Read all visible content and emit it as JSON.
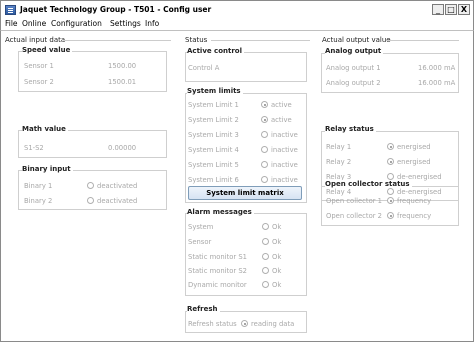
{
  "window": {
    "title": "Jaquet Technology Group - T501 - Config user",
    "minimize": "_",
    "maximize": "□",
    "close": "X"
  },
  "menu": [
    "File",
    "Online",
    "Configuration",
    "Settings",
    "Info"
  ],
  "left": {
    "title": "Actual input data",
    "speed": {
      "title": "Speed value",
      "rows": [
        {
          "label": "Sensor 1",
          "value": "1500.00"
        },
        {
          "label": "Sensor 2",
          "value": "1500.01"
        }
      ]
    },
    "math": {
      "title": "Math value",
      "rows": [
        {
          "label": "S1-S2",
          "value": "0.00000"
        }
      ]
    },
    "binary": {
      "title": "Binary input",
      "rows": [
        {
          "label": "Binary 1",
          "state": "deactivated",
          "checked": false
        },
        {
          "label": "Binary 2",
          "state": "deactivated",
          "checked": false
        }
      ]
    }
  },
  "middle": {
    "title": "Status",
    "active_control": {
      "title": "Active control",
      "value": "Control A"
    },
    "limits": {
      "title": "System limits",
      "rows": [
        {
          "label": "System Limit 1",
          "state": "active",
          "checked": true
        },
        {
          "label": "System Limit 2",
          "state": "active",
          "checked": true
        },
        {
          "label": "System Limit 3",
          "state": "inactive",
          "checked": false
        },
        {
          "label": "System Limit 4",
          "state": "inactive",
          "checked": false
        },
        {
          "label": "System Limit 5",
          "state": "inactive",
          "checked": false
        },
        {
          "label": "System Limit 6",
          "state": "inactive",
          "checked": false
        }
      ],
      "matrix_button": "System limit matrix"
    },
    "alarms": {
      "title": "Alarm messages",
      "rows": [
        {
          "label": "System",
          "state": "Ok",
          "checked": false
        },
        {
          "label": "Sensor",
          "state": "Ok",
          "checked": false
        },
        {
          "label": "Static monitor S1",
          "state": "Ok",
          "checked": false
        },
        {
          "label": "Static monitor S2",
          "state": "Ok",
          "checked": false
        },
        {
          "label": "Dynamic monitor",
          "state": "Ok",
          "checked": false
        }
      ]
    },
    "refresh": {
      "title": "Refresh",
      "label": "Refresh status",
      "state": "reading data",
      "checked": true
    }
  },
  "right": {
    "title": "Actual output value",
    "analog": {
      "title": "Analog output",
      "rows": [
        {
          "label": "Analog output 1",
          "value": "16.000 mA"
        },
        {
          "label": "Analog output 2",
          "value": "16.000 mA"
        }
      ]
    },
    "relay": {
      "title": "Relay status",
      "rows": [
        {
          "label": "Relay 1",
          "state": "energised",
          "checked": true
        },
        {
          "label": "Relay 2",
          "state": "energised",
          "checked": true
        },
        {
          "label": "Relay 3",
          "state": "de-energised",
          "checked": false
        },
        {
          "label": "Relay 4",
          "state": "de-energised",
          "checked": false
        }
      ]
    },
    "open_collector": {
      "title": "Open collector status",
      "rows": [
        {
          "label": "Open collector 1",
          "state": "frequency",
          "checked": true
        },
        {
          "label": "Open collector 2",
          "state": "frequency",
          "checked": true
        }
      ]
    }
  }
}
